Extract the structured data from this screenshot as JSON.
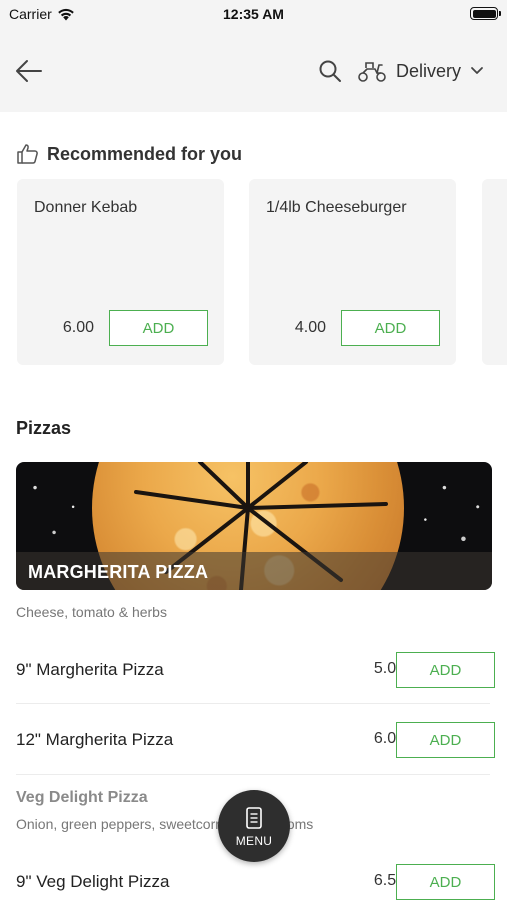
{
  "status_bar": {
    "carrier": "Carrier",
    "time": "12:35 AM"
  },
  "nav": {
    "delivery_label": "Delivery"
  },
  "recommended": {
    "title": "Recommended for you",
    "items": [
      {
        "name": "Donner Kebab",
        "price": "6.00",
        "add_label": "ADD"
      },
      {
        "name": "1/4lb Cheeseburger",
        "price": "4.00",
        "add_label": "ADD"
      }
    ]
  },
  "pizzas": {
    "section_title": "Pizzas",
    "banner_caption": "MARGHERITA PIZZA",
    "description": "Cheese, tomato & herbs",
    "items": [
      {
        "name": "9\" Margherita Pizza",
        "price": "5.00",
        "add_label": "ADD"
      },
      {
        "name": "12\" Margherita Pizza",
        "price": "6.00",
        "add_label": "ADD"
      }
    ],
    "veg": {
      "title": "Veg Delight Pizza",
      "description": "Onion, green peppers, sweetcorn & mushrooms",
      "items": [
        {
          "name": "9\" Veg Delight Pizza",
          "price": "6.50",
          "add_label": "ADD"
        }
      ]
    }
  },
  "menu_fab": {
    "label": "MENU"
  },
  "colors": {
    "accent": "#4caf50",
    "nav_bg": "#f4f4f4",
    "fab_bg": "#2e2e2e"
  }
}
